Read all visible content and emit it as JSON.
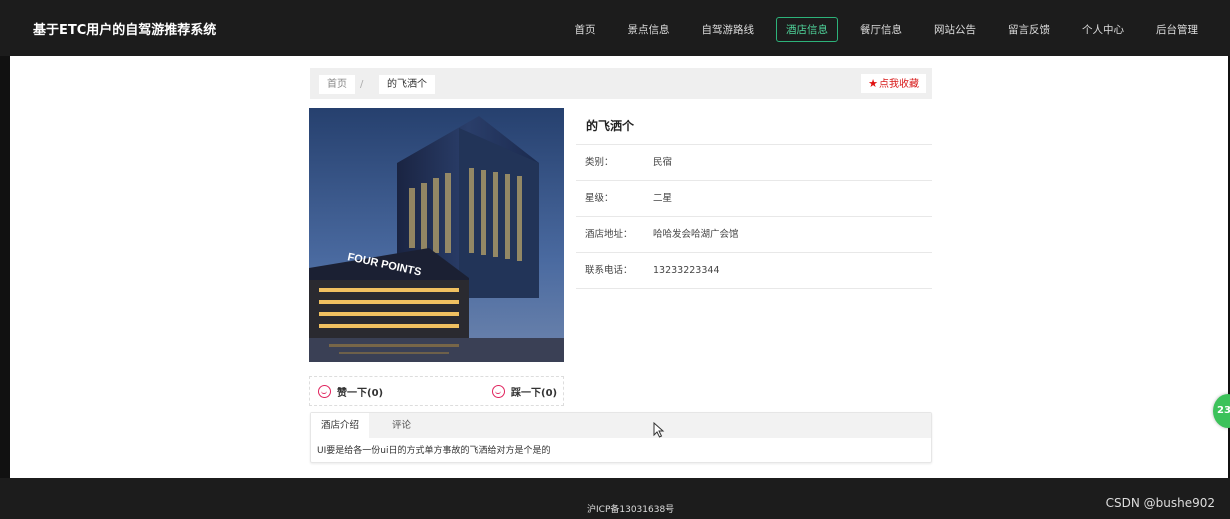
{
  "header": {
    "brand": "基于ETC用户的自驾游推荐系统",
    "nav": [
      {
        "label": "首页"
      },
      {
        "label": "景点信息"
      },
      {
        "label": "自驾游路线"
      },
      {
        "label": "酒店信息",
        "active": true
      },
      {
        "label": "餐厅信息"
      },
      {
        "label": "网站公告"
      },
      {
        "label": "留言反馈"
      },
      {
        "label": "个人中心"
      },
      {
        "label": "后台管理"
      }
    ]
  },
  "breadcrumb": {
    "home": "首页",
    "separator": "/",
    "current": "的飞洒个",
    "favorite_label": "点我收藏",
    "favorite_icon": "star-icon"
  },
  "hotel": {
    "name": "的飞洒个",
    "fields": [
      {
        "key": "类别：",
        "value": "民宿"
      },
      {
        "key": "星级：",
        "value": "二星"
      },
      {
        "key": "酒店地址：",
        "value": "哈哈发会哈湖广会馆"
      },
      {
        "key": "联系电话：",
        "value": "13233223344"
      }
    ],
    "image_sign": "FOUR POINTS"
  },
  "votes": {
    "up_label": "赞一下(0)",
    "down_label": "踩一下(0)"
  },
  "tabs": {
    "items": [
      {
        "label": "酒店介绍",
        "active": true
      },
      {
        "label": "评论"
      }
    ],
    "content": "UI要是给各一份ui日的方式单方事故的飞洒给对方是个是的"
  },
  "badge": "23",
  "footer": {
    "icp": "沪ICP备13031638号",
    "watermark": "CSDN @bushe902"
  },
  "colors": {
    "nav_bg": "#1c1c1c",
    "active_nav": "#4fd39a",
    "favorite": "#d81919",
    "badge": "#3cc25a"
  }
}
